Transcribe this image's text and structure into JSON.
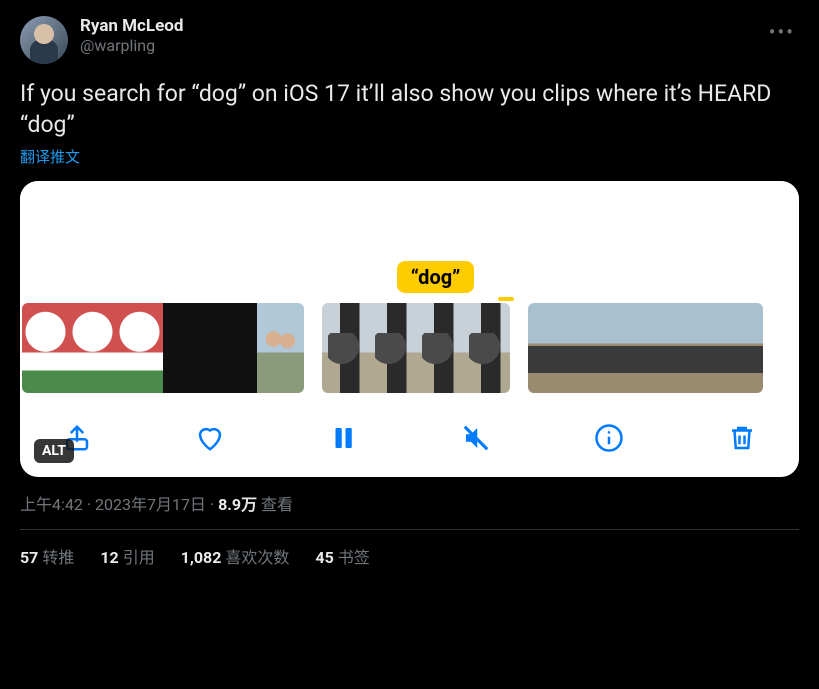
{
  "author": {
    "display_name": "Ryan McLeod",
    "handle": "@warpling"
  },
  "tweet_text": "If you search for “dog” on iOS 17 it’ll also show you clips where it’s HEARD “dog”",
  "translate_label": "翻译推文",
  "media": {
    "badge_text": "“dog”",
    "alt_label": "ALT",
    "toolbar_icons": [
      "share",
      "like",
      "pause",
      "mute",
      "info",
      "delete"
    ]
  },
  "meta": {
    "time": "上午4:42",
    "date": "2023年7月17日",
    "views_number": "8.9万",
    "views_label": "查看",
    "separator": " · "
  },
  "stats": {
    "retweets": {
      "count": "57",
      "label": "转推"
    },
    "quotes": {
      "count": "12",
      "label": "引用"
    },
    "likes": {
      "count": "1,082",
      "label": "喜欢次数"
    },
    "bookmarks": {
      "count": "45",
      "label": "书签"
    }
  }
}
